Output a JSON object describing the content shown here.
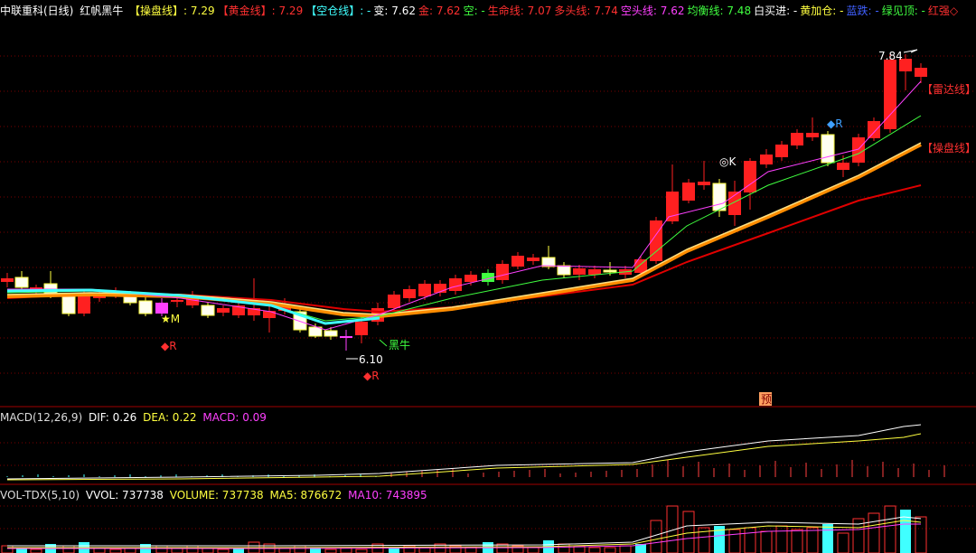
{
  "colors": {
    "up": "#ff2020",
    "down": "#00d0ff",
    "bg": "#000000",
    "grid": "#7a0000",
    "yellow": "#ffff40",
    "cyan": "#40ffff",
    "magenta": "#ff40ff",
    "green": "#40ff40",
    "white": "#ffffff",
    "red": "#ff3030"
  },
  "header": {
    "stock": "中联重科(日线)",
    "indicator": "红帆黑牛",
    "items": [
      {
        "label": "【操盘线】",
        "value": ": 7.29",
        "color": "#ffff40"
      },
      {
        "label": "【黄金线】",
        "value": ": 7.29",
        "color": "#ff3030"
      },
      {
        "label": "【空仓线】",
        "value": ": -",
        "color": "#40ffff"
      },
      {
        "label": "变",
        "value": ": 7.62",
        "color": "#ffffff"
      },
      {
        "label": "金",
        "value": ": 7.62",
        "color": "#ff3030"
      },
      {
        "label": "空",
        "value": ": -",
        "color": "#40ff40"
      },
      {
        "label": "生命线",
        "value": ": 7.07",
        "color": "#ff3030"
      },
      {
        "label": "多头线",
        "value": ": 7.74",
        "color": "#ff3030"
      },
      {
        "label": "空头线",
        "value": ": 7.62",
        "color": "#ff40ff"
      },
      {
        "label": "均衡线",
        "value": ": 7.48",
        "color": "#40ff40"
      },
      {
        "label": "白买进",
        "value": ": -",
        "color": "#ffffff"
      },
      {
        "label": "黄加仓",
        "value": ": -",
        "color": "#ffff40"
      },
      {
        "label": "蓝跌",
        "value": ": -",
        "color": "#4060ff"
      },
      {
        "label": "绿见顶",
        "value": ": -",
        "color": "#40ff40"
      },
      {
        "label": "红强",
        "value": "◇",
        "color": "#ff3030"
      }
    ]
  },
  "annotations": {
    "high_price": "7.84",
    "low_price": "6.10",
    "radar_line": "【雷达线】",
    "op_line": "【操盘线】",
    "black_bull": "黑牛",
    "star_m": "★M",
    "r1": "◆R",
    "r2": "◆R",
    "r3": "◆R",
    "ok": "◎K",
    "yu": "预"
  },
  "macd": {
    "title": "MACD(12,26,9)",
    "dif_label": "DIF: 0.26",
    "dea_label": "DEA: 0.22",
    "macd_label": "MACD: 0.09"
  },
  "vol": {
    "title": "VOL-TDX(5,10)",
    "vvol_label": "VVOL: 737738",
    "volume_label": "VOLUME: 737738",
    "ma5_label": "MA5: 876672",
    "ma10_label": "MA10: 743895"
  }
}
